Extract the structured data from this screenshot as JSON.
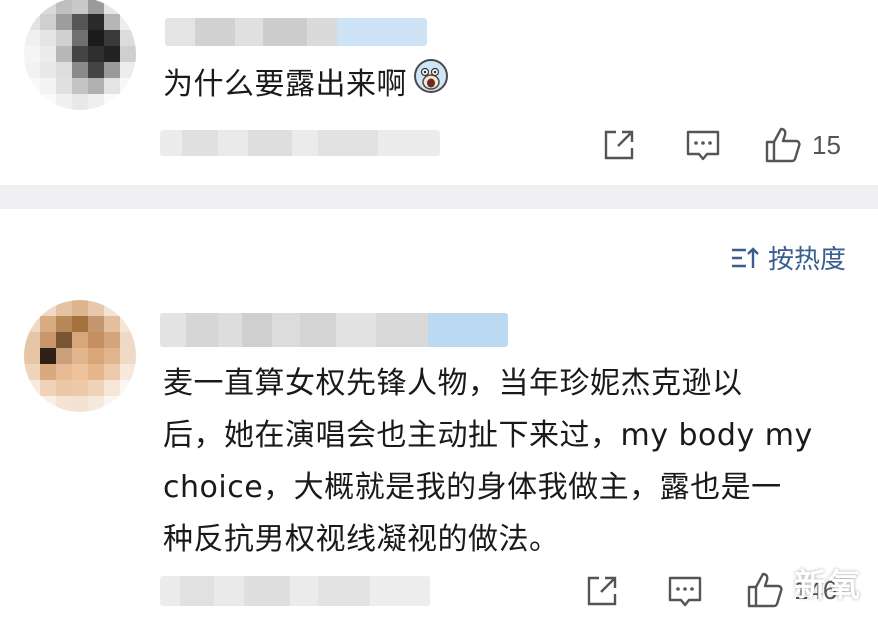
{
  "comments": [
    {
      "text": "为什么要露出来啊",
      "emoji_icon": "shocked-face-emoji-icon",
      "like_count": "15"
    },
    {
      "lines": [
        "麦一直算女权先锋人物，当年珍妮杰克逊以",
        "后，她在演唱会也主动扯下来过，my body my",
        "choice，大概就是我的身体我做主，露也是一",
        "种反抗男权视线凝视的做法。"
      ],
      "like_count": "146"
    }
  ],
  "sort": {
    "label": "按热度",
    "icon": "sort-icon"
  },
  "watermark": "新氧",
  "colors": {
    "accent": "#3a5f8f",
    "divider": "#f0f0f2",
    "name_highlight": "#cfe3f7"
  }
}
